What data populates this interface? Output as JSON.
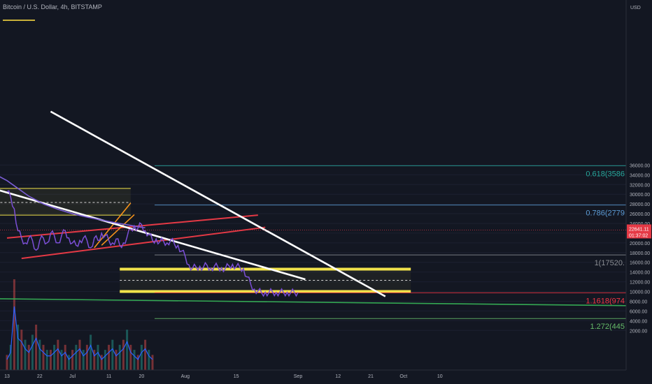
{
  "header": {
    "symbol_title": "Bitcoin / U.S. Dollar, 4h, BITSTAMP"
  },
  "colors": {
    "background": "#131722",
    "price": "#7b4fd6",
    "ma": "#7b5ed6",
    "trend_white": "#ffffff",
    "channel_red": "#e53945",
    "box_yellow": "#f1e34b",
    "long_green": "#34a853",
    "fib_0618": "#26a69a",
    "fib_0786": "#5b9bd5",
    "fib_1": "#8a8d93",
    "fib_11618": "#f23645",
    "fib_1272": "#66bb6a",
    "last_price_bg": "#e53945"
  },
  "chart_data": {
    "type": "line",
    "title": "Bitcoin / U.S. Dollar, 4h, BITSTAMP",
    "y_unit": "USD",
    "ylim": [
      1000,
      38000
    ],
    "y_ticks": [
      2000,
      4000,
      6000,
      8000,
      10000,
      12000,
      14000,
      16000,
      18000,
      20000,
      22000,
      24000,
      26000,
      28000,
      30000,
      32000,
      34000,
      36000
    ],
    "y_tick_labels": [
      "2000.00",
      "4000.00",
      "6000.00",
      "8000.00",
      "10000.00",
      "12000.00",
      "14000.00",
      "16000.00",
      "18000.00",
      "20000.00",
      "22000.00",
      "24000.00",
      "26000.00",
      "28000.00",
      "30000.00",
      "32000.00",
      "34000.00",
      "36000.00"
    ],
    "x_tick_labels": [
      "13",
      "22",
      "Jul",
      "11",
      "20",
      "Aug",
      "15",
      "Sep",
      "12",
      "21",
      "Oct",
      "10"
    ],
    "x_ticks_day": [
      0,
      9,
      18,
      28,
      37,
      49,
      63,
      80,
      91,
      100,
      109,
      119
    ],
    "price_series": {
      "name": "",
      "day": [
        0,
        1,
        2,
        3,
        4,
        5,
        6,
        7,
        8,
        9,
        10,
        11,
        12,
        13,
        14,
        15,
        16,
        17,
        18,
        19,
        20,
        21,
        22,
        23,
        24,
        25,
        26,
        27,
        28,
        29,
        30,
        31,
        32,
        33,
        34,
        35,
        36,
        37,
        38,
        39,
        40,
        41,
        42,
        43,
        44,
        45,
        46,
        47,
        48,
        49,
        50,
        51,
        52,
        53,
        54,
        55,
        56,
        57,
        58,
        59,
        60,
        61,
        62,
        63,
        64,
        65,
        66,
        67,
        68,
        69,
        70,
        71,
        72,
        73,
        74,
        75,
        76,
        77,
        78,
        79,
        80
      ],
      "close": [
        30500,
        29500,
        27000,
        22500,
        21000,
        20000,
        21000,
        20500,
        18500,
        20500,
        21000,
        20000,
        22000,
        21500,
        20000,
        21500,
        22500,
        21000,
        20000,
        19500,
        20500,
        21000,
        20500,
        19000,
        21000,
        20500,
        22000,
        21500,
        20500,
        20000,
        20800,
        19500,
        20000,
        21200,
        22800,
        23500,
        23000,
        23800,
        22500,
        21800,
        20500,
        20800,
        20200,
        20400,
        20000,
        20600,
        19800,
        19500,
        18300,
        17200,
        15500,
        14800,
        15000,
        15200,
        15000,
        15400,
        14800,
        15200,
        15000,
        14900,
        14700,
        15300,
        15600,
        15100,
        15000,
        14700,
        13000,
        11500,
        10500,
        10100,
        9700,
        9850,
        9800,
        9900,
        9800,
        9850,
        9800,
        9850,
        9800,
        9800,
        9800
      ]
    },
    "ma_series": {
      "name": "",
      "day": [
        -3,
        0,
        3,
        6,
        10,
        14,
        18,
        22,
        26,
        30,
        34,
        36,
        38
      ],
      "value": [
        34000,
        32800,
        31200,
        29600,
        28000,
        26900,
        26000,
        25300,
        24700,
        24100,
        23600,
        23300,
        23100
      ]
    },
    "volume_series": {
      "name": "",
      "day": [
        0,
        1,
        2,
        3,
        4,
        5,
        6,
        7,
        8,
        9,
        10,
        11,
        12,
        13,
        14,
        15,
        16,
        17,
        18,
        19,
        20,
        21,
        22,
        23,
        24,
        25,
        26,
        27,
        28,
        29,
        30,
        31,
        32,
        33,
        34,
        35,
        36,
        37,
        38,
        39,
        40
      ],
      "volume": [
        0.3,
        0.5,
        1.8,
        0.9,
        0.8,
        0.6,
        0.5,
        0.7,
        0.9,
        0.6,
        0.5,
        0.4,
        0.4,
        0.5,
        0.6,
        0.4,
        0.5,
        0.3,
        0.4,
        0.5,
        0.6,
        0.4,
        0.5,
        0.7,
        0.4,
        0.5,
        0.3,
        0.4,
        0.5,
        0.6,
        0.4,
        0.5,
        0.6,
        0.8,
        0.5,
        0.4,
        0.3,
        0.5,
        0.6,
        0.4,
        0.3
      ]
    },
    "fib_levels": [
      {
        "label": "0.618(3586",
        "value": 35860,
        "color": "#26a69a"
      },
      {
        "label": "0.786(2779",
        "value": 27790,
        "color": "#5b9bd5"
      },
      {
        "label": "1(17520.",
        "value": 17520,
        "color": "#8a8d93"
      },
      {
        "label": "1.1618(974",
        "value": 9740,
        "color": "#f23645"
      },
      {
        "label": "1.272(445",
        "value": 4450,
        "color": "#66bb6a"
      }
    ],
    "last_price": {
      "value_label": "22641.11",
      "countdown": "01:37:02",
      "value": 22641.11
    },
    "drawings": {
      "white_lines": [
        {
          "from": [
            -3,
            31000
          ],
          "to": [
            82,
            12500
          ]
        },
        {
          "from": [
            12,
            47000
          ],
          "to": [
            104,
            9000
          ]
        }
      ],
      "red_channel": [
        {
          "from": [
            0,
            21000
          ],
          "to": [
            69,
            25700
          ]
        },
        {
          "from": [
            4,
            16800
          ],
          "to": [
            71,
            23200
          ]
        }
      ],
      "orange_lines": [
        {
          "from": [
            24,
            19000
          ],
          "to": [
            34,
            28200
          ]
        },
        {
          "from": [
            26,
            19500
          ],
          "to": [
            35,
            25800
          ]
        }
      ],
      "green_line": {
        "from": [
          -3,
          8500
        ],
        "to": [
          130,
          7100
        ]
      },
      "yellow_box_top": {
        "day_range": [
          -3,
          34
        ],
        "top": 31200,
        "mid": 28300,
        "bottom": 25700
      },
      "yellow_box_main": {
        "day_range": [
          31,
          111
        ],
        "top": 14600,
        "mid": 12300,
        "bottom": 10000
      }
    }
  }
}
